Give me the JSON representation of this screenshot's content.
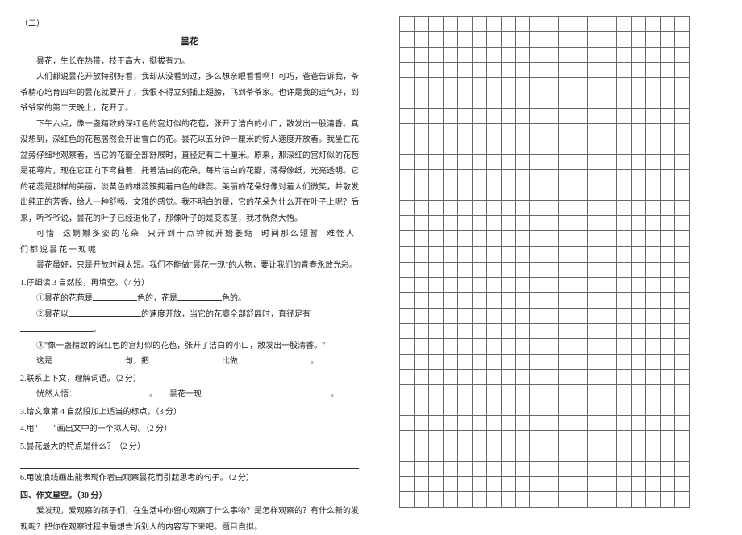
{
  "left": {
    "section_no": "（二）",
    "title": "昙花",
    "p1": "昙花，生长在热带，枝干高大，挺拔有力。",
    "p2": "人们都说昙花开放特别好看，我却从没看到过，多么想亲眼看看啊！可巧，爸爸告诉我，爷爷精心培育四年的昙花就要开了，我恨不得立刻插上翅膀，飞到爷爷家。也许是我的运气好，到爷爷家的第二天晚上，花开了。",
    "p3": "下午六点，像一盏精致的深红色的宫灯似的花苞，张开了洁白的小口，散发出一股清香。真没想到，深红色的花苞居然会开出雪白的花。昙花以五分钟一厘米的惊人速度开放着。我坐在花盆旁仔细地观察着，当它的花瓣全部舒展时，直径足有二十厘米。原来，那深红的宫灯似的花苞是花萼片，现在它正向下弯曲着，托着洁白的花朵，每片洁白的花瓣，薄得像纸，光亮透明。它的花蕊是那样的美丽，淡黄色的雄蕊簇拥着白色的雌蕊。美丽的花朵好像对着人们微笑，并散发出纯正的芳香，给人一种舒畅、文雅的感觉。我不明白的是，它的花朵为什么开在叶子上呢？后来，听爷爷说，昙花的叶子已经退化了，那像叶子的是变态茎，我才恍然大悟。",
    "p4_a": "可惜",
    "p4_b": "这婀娜多姿的花朵",
    "p4_c": "只开到十点钟就开始萎缩",
    "p4_d": "时间那么短暂",
    "p4_e": "难怪人们都说昙花一现呢",
    "p5": "昙花虽好，只是开放时间太短。我们不能做\"昙花一现\"的人物，要让我们的青春永放光彩。",
    "q1": "1.仔细读 3 自然段，再填空。（7 分）",
    "q1a_pre": "①昙花的花苞是",
    "q1a_mid": "色的，花是",
    "q1a_end": "色的。",
    "q1b_pre": "②昙花以",
    "q1b_mid": "的速度开放，当它的花瓣全部舒展时，直径足有",
    "q1b_end": "。",
    "q1c": "③\"像一盏精致的深红色的宫灯似的花苞，张开了洁白的小口，散发出一股清香。\"",
    "q1c_line2_pre": "这是",
    "q1c_line2_mid": "句，把",
    "q1c_line2_mid2": "比做",
    "q1c_line2_end": "。",
    "q2": "2.联系上下文，理解词语。（2 分）",
    "q2a": "恍然大悟：",
    "q2a_end": "。",
    "q2b_pre": "昙花一现",
    "q2b_end": "。",
    "q3": "3.给文章第 4 自然段加上适当的标点。（3 分）",
    "q4": "4.用\"　　\"画出文中的一个拟人句。（2 分）",
    "q5": "5.昙花最大的特点是什么？（2 分）",
    "q6": "6.用波浪线画出能表现作者由观察昙花而引起思考的句子。（2 分）",
    "essay_heading": "四、作文星空。（30 分）",
    "essay_body": "爱发现，爱观察的孩子们，在生活中你留心观察了什么事物？是怎样观察的？有什么新的发现呢？把你在观察过程中最想告诉别人的内容写下来吧。题目自拟。"
  },
  "grid": {
    "rows": 32,
    "cols": 20
  }
}
